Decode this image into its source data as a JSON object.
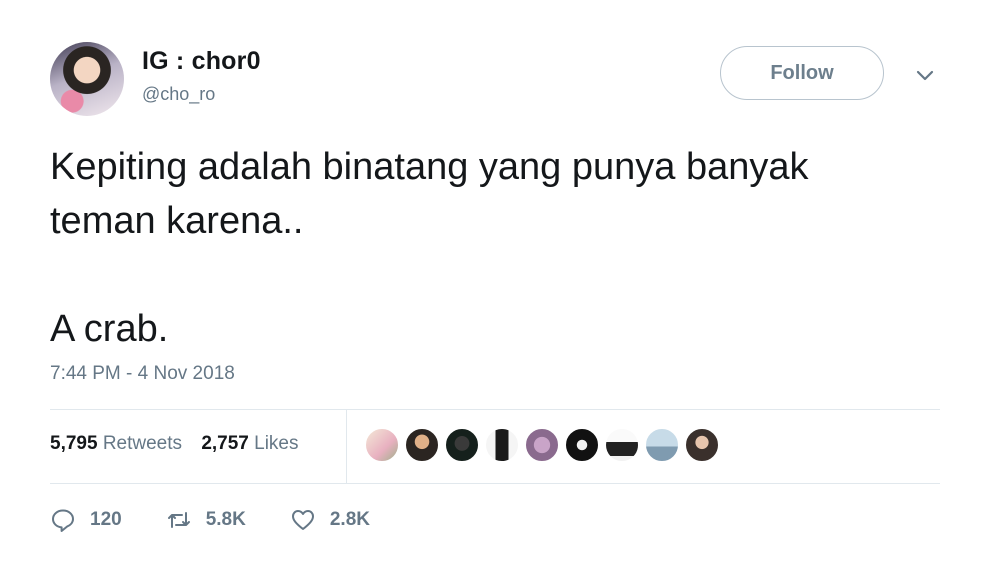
{
  "author": {
    "display_name": "IG : chor0",
    "handle": "@cho_ro"
  },
  "follow_label": "Follow",
  "tweet": {
    "line1": "Kepiting adalah binatang yang punya banyak",
    "line2": "teman karena..",
    "line3": "A crab."
  },
  "timestamp": "7:44 PM - 4 Nov 2018",
  "stats": {
    "retweets_count": "5,795",
    "retweets_label": "Retweets",
    "likes_count": "2,757",
    "likes_label": "Likes"
  },
  "actions": {
    "replies": "120",
    "retweets": "5.8K",
    "likes": "2.8K"
  },
  "colors": {
    "text": "#14171a",
    "muted": "#657786",
    "divider": "#e1e8ed",
    "follow_border": "#b8c4ce"
  },
  "likers": [
    "linear-gradient(135deg,#f4e9d7,#e8b0c0 60%,#9fb08a)",
    "radial-gradient(circle at 50% 40%,#e0b088 0 28%,#2b2521 30%)",
    "radial-gradient(circle at 50% 45%,#3a3a3a 0 30%,#15201c 32%)",
    "linear-gradient(90deg,#f5f5f5 0 30%,#1a1a1a 30% 70%,#f5f5f5 70%)",
    "radial-gradient(circle at 50% 50%,#c9a4c8 0 35%,#8a6a8e 37%)",
    "radial-gradient(circle at 50% 50%,#f0f0f0 0 22%,#111 24%)",
    "linear-gradient(180deg,#fafafa 0 40%,#222 40% 85%,#f2f2f2 85%)",
    "linear-gradient(180deg,#c7dbe8 0 55%,#7f9bb0 55%)",
    "radial-gradient(circle at 50% 42%,#e7c5ad 0 26%,#3a302c 28%)"
  ]
}
